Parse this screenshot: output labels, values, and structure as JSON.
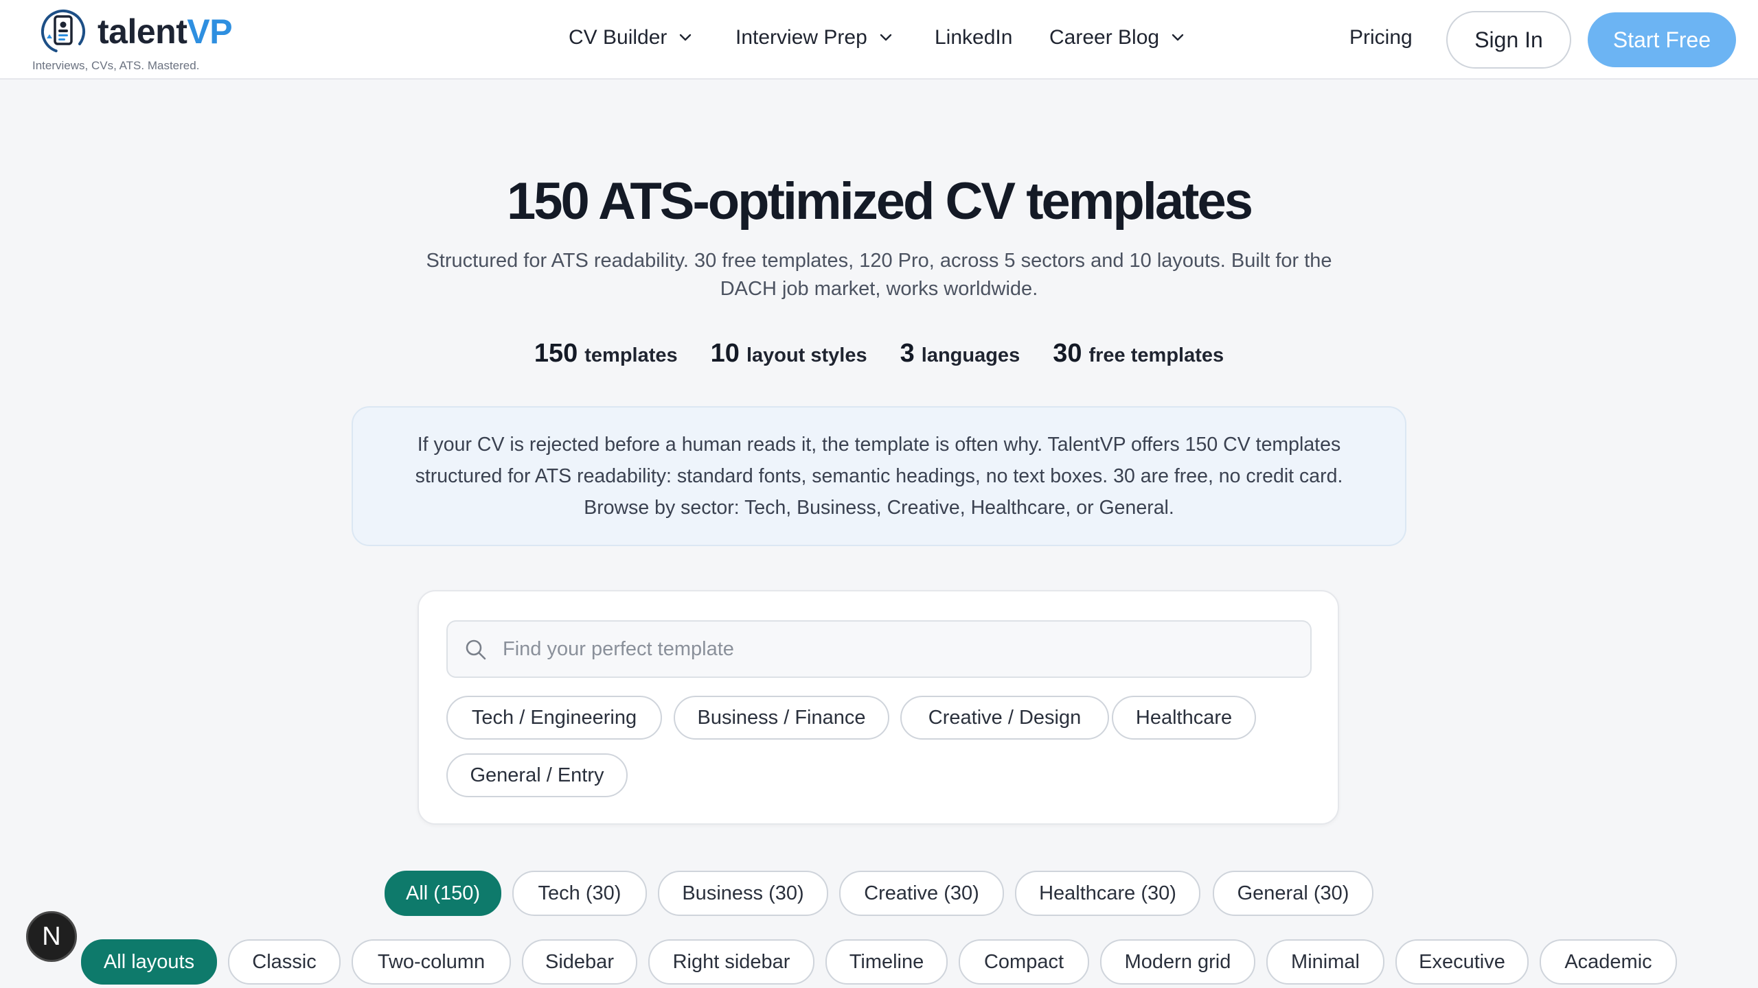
{
  "brand": {
    "name_part1": "talent",
    "name_part2": "VP",
    "tagline": "Interviews, CVs, ATS. Mastered."
  },
  "nav": {
    "items": [
      {
        "label": "CV Builder",
        "dropdown": true
      },
      {
        "label": "Interview Prep",
        "dropdown": true
      },
      {
        "label": "LinkedIn",
        "dropdown": false
      },
      {
        "label": "Career Blog",
        "dropdown": true
      }
    ],
    "pricing": "Pricing",
    "sign_in": "Sign In",
    "start_free": "Start Free"
  },
  "hero": {
    "title": "150 ATS-optimized CV templates",
    "subtitle": "Structured for ATS readability. 30 free templates, 120 Pro, across 5 sectors and 10 layouts. Built for the DACH job market, works worldwide.",
    "stats": [
      {
        "num": "150",
        "label": "templates"
      },
      {
        "num": "10",
        "label": "layout styles"
      },
      {
        "num": "3",
        "label": "languages"
      },
      {
        "num": "30",
        "label": "free templates"
      }
    ]
  },
  "info": {
    "text": "If your CV is rejected before a human reads it, the template is often why. TalentVP offers 150 CV templates structured for ATS readability: standard fonts, semantic headings, no text boxes. 30 are free, no credit card. Browse by sector: Tech, Business, Creative, Healthcare, or General."
  },
  "search": {
    "placeholder": "Find your perfect template",
    "value": "",
    "sectors": [
      "Tech / Engineering",
      "Business / Finance",
      "Creative / Design",
      "Healthcare",
      "General / Entry"
    ]
  },
  "filters": {
    "sector_counts": [
      "All (150)",
      "Tech (30)",
      "Business (30)",
      "Creative (30)",
      "Healthcare (30)",
      "General (30)"
    ],
    "layouts": [
      "All layouts",
      "Classic",
      "Two-column",
      "Sidebar",
      "Right sidebar",
      "Timeline",
      "Compact",
      "Modern grid",
      "Minimal",
      "Executive",
      "Academic"
    ]
  },
  "fab": {
    "label": "N"
  },
  "colors": {
    "brand_blue": "#2e8fe0",
    "accent_teal": "#0e7a6b",
    "cta_blue": "#6cb4f3"
  }
}
